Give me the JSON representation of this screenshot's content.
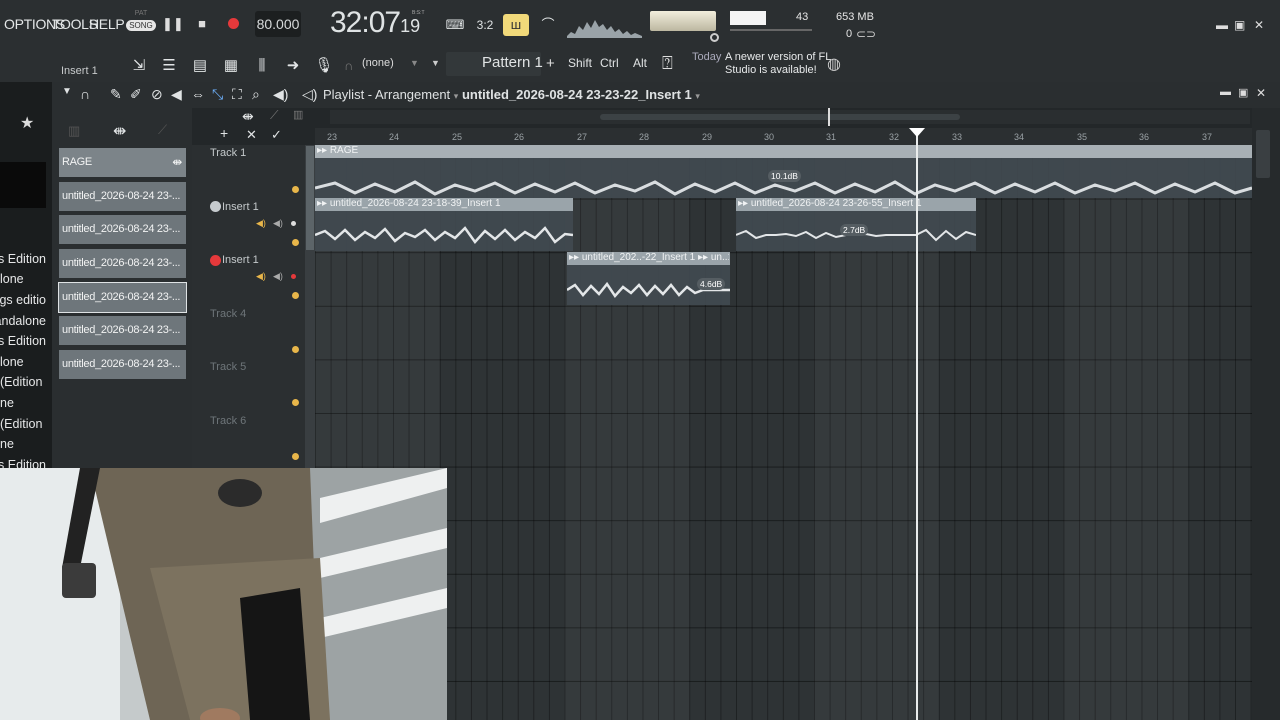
{
  "menu": {
    "options": "OPTIONS",
    "tools": "TOOLS",
    "help": "HELP"
  },
  "transport": {
    "mode_pat": "PAT",
    "mode_song": "SONG",
    "tempo": "80.000",
    "time_main": "32:07",
    "time_sub": "19",
    "time_unit": "B:S:T"
  },
  "stats": {
    "cpu": "43",
    "memory": "653 MB",
    "polyphony": "0"
  },
  "toolbar2": {
    "insert_label": "Insert 1",
    "channel_select": "(none)",
    "pattern": "Pattern 1",
    "shift": "Shift",
    "ctrl": "Ctrl",
    "alt": "Alt",
    "hint_today": "Today",
    "hint_text": "A newer version of FL Studio is available!"
  },
  "browser": {
    "items": [
      "s Edition)",
      "lone",
      "gs editio",
      "andalone",
      "s Edition)",
      "lone",
      " Edition)",
      "ne",
      " Edition)",
      "ne",
      "s Edition)"
    ]
  },
  "playlist": {
    "title": "Playlist - Arrangement",
    "arrangement": "untitled_2026-08-24 23-23-22_Insert 1"
  },
  "picker": {
    "items": [
      "RAGE",
      "untitled_2026-08-24 23-...",
      "untitled_2026-08-24 23-...",
      "untitled_2026-08-24 23-...",
      "untitled_2026-08-24 23-...",
      "untitled_2026-08-24 23-...",
      "untitled_2026-08-24 23-..."
    ]
  },
  "ruler": {
    "bars": [
      "23",
      "24",
      "25",
      "26",
      "27",
      "28",
      "29",
      "30",
      "31",
      "32",
      "33",
      "34",
      "35",
      "36",
      "37"
    ]
  },
  "tracks": [
    "Track 1",
    "Insert 1",
    "Insert 1",
    "Track 4",
    "Track 5",
    "Track 6"
  ],
  "clips": {
    "rage": {
      "title": "RAGE",
      "volume": "10.1dB"
    },
    "clip_a": {
      "title": "untitled_2026-08-24 23-18-39_Insert 1"
    },
    "clip_b": {
      "title": "untitled_2026-08-24 23-26-55_Insert 1",
      "volume": "2.7dB"
    },
    "clip_c": {
      "title": "untitled_202..-22_Insert 1",
      "title2": "un..1",
      "volume": "4.6dB"
    }
  },
  "colors": {
    "record": "#e5393b",
    "playhead": "#e9ecec",
    "track_dot": "#e8b64a",
    "clip_header": "#9aa4aa",
    "grid": "#2e3335"
  }
}
